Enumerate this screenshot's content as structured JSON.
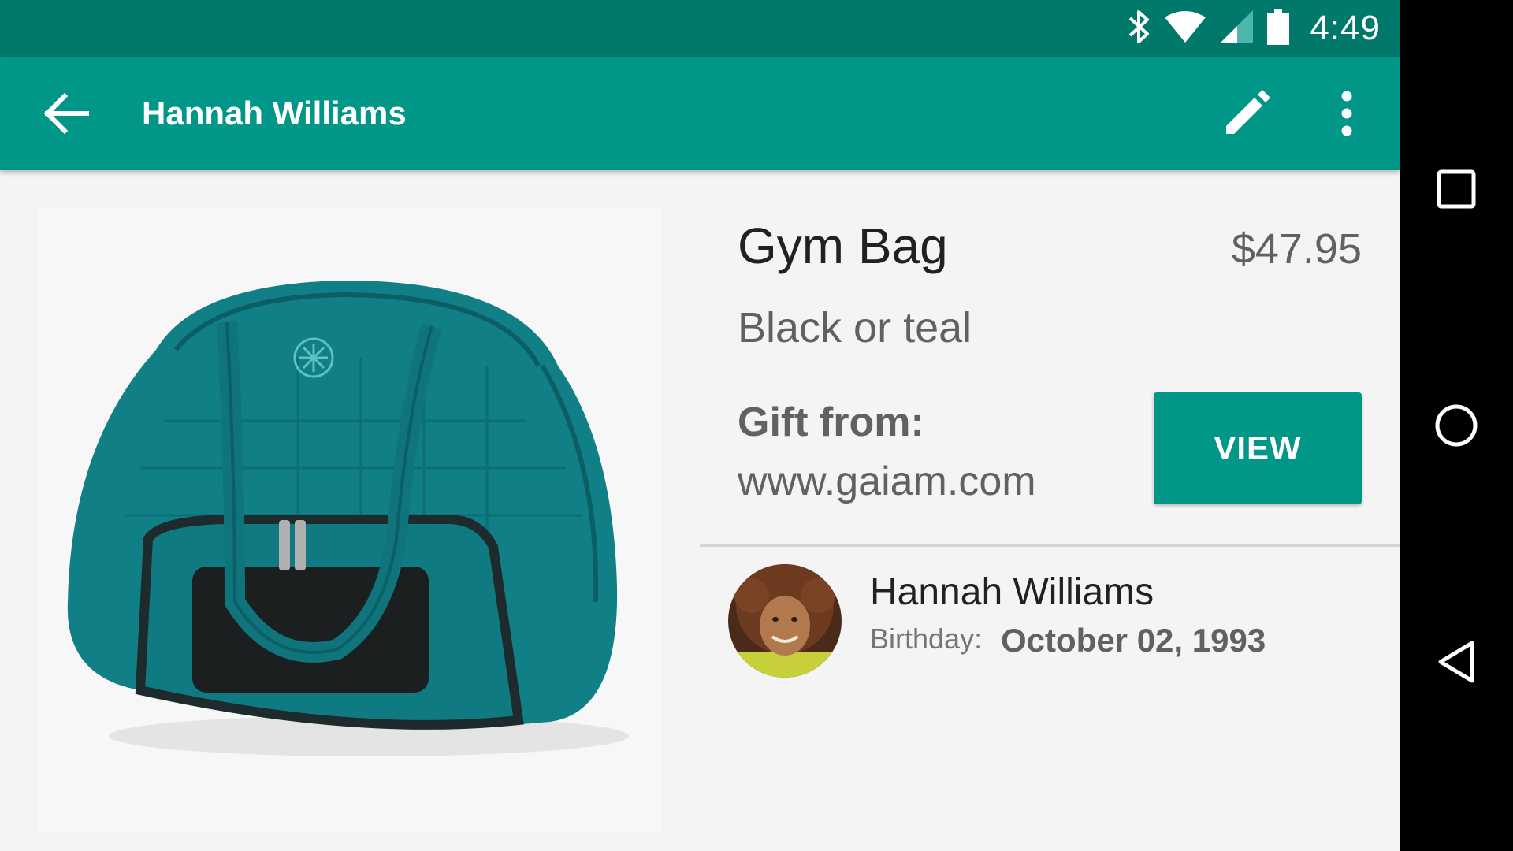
{
  "status_bar": {
    "time": "4:49",
    "icons": [
      "bluetooth-icon",
      "wifi-icon",
      "cell-signal-icon",
      "battery-icon"
    ],
    "color": "#00796b"
  },
  "app_bar": {
    "title": "Hannah Williams",
    "color": "#009688",
    "actions": [
      "back-arrow-icon",
      "edit-pencil-icon",
      "more-vert-icon"
    ]
  },
  "product": {
    "name": "Gym Bag",
    "price": "$47.95",
    "variant": "Black or teal",
    "gift_label": "Gift from:",
    "gift_source": "www.gaiam.com",
    "view_button": "VIEW"
  },
  "person": {
    "name": "Hannah Williams",
    "birthday_label": "Birthday:",
    "birthday": "October 02, 1993"
  },
  "nav_bar": {
    "buttons": [
      "recents-square-icon",
      "home-circle-icon",
      "back-triangle-icon"
    ]
  }
}
